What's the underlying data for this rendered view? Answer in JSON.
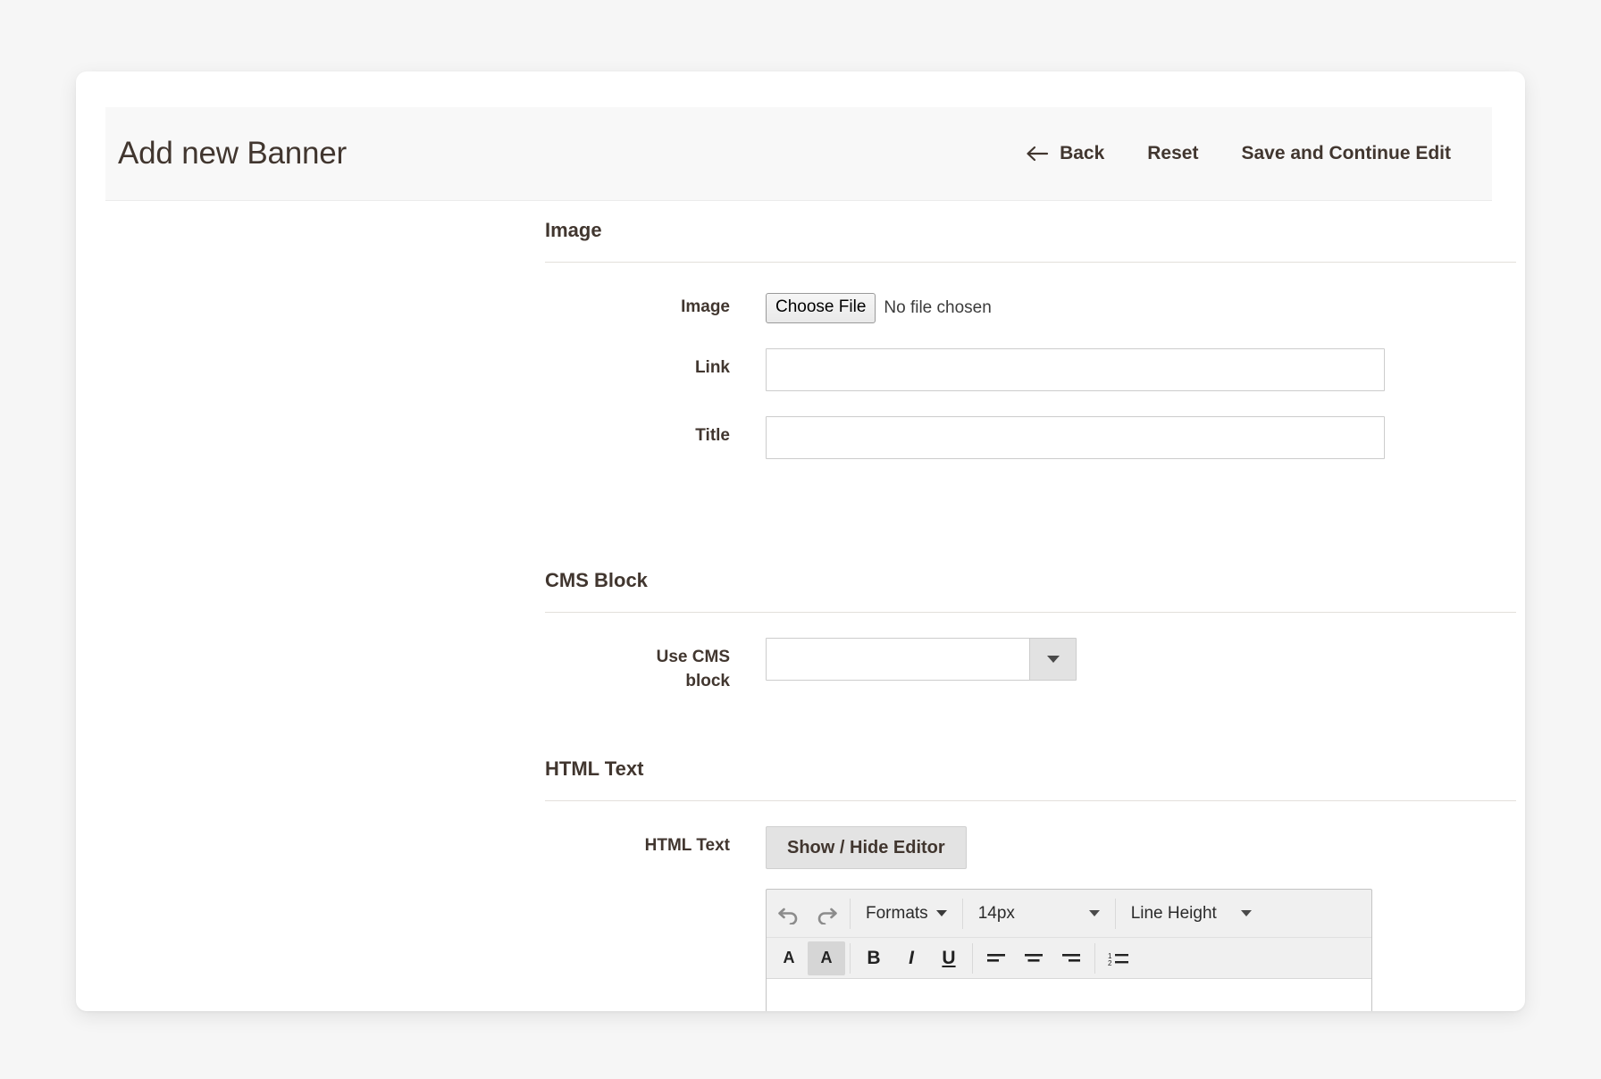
{
  "header": {
    "title": "Add new Banner",
    "actions": [
      {
        "id": "back",
        "label": "Back",
        "icon": "arrow-left-icon"
      },
      {
        "id": "reset",
        "label": "Reset",
        "icon": ""
      },
      {
        "id": "save",
        "label": "Save and Continue Edit",
        "icon": ""
      }
    ]
  },
  "fieldsets": {
    "image": {
      "legend": "Image",
      "fields": {
        "image": {
          "label": "Image",
          "button_label": "Choose File",
          "status": "No file chosen"
        },
        "link": {
          "label": "Link",
          "value": "",
          "placeholder": ""
        },
        "title": {
          "label": "Title",
          "value": "",
          "placeholder": ""
        }
      }
    },
    "cms_block": {
      "legend": "CMS Block",
      "fields": {
        "use_cms_block": {
          "label_line1": "Use CMS",
          "label_line2": "block",
          "value": "",
          "options": [
            ""
          ]
        }
      }
    },
    "html_text": {
      "legend": "HTML Text",
      "fields": {
        "html_text": {
          "label": "HTML Text",
          "toggle_label": "Show / Hide Editor"
        }
      }
    }
  },
  "editor": {
    "toolbar_row1": [
      {
        "id": "undo",
        "type": "icon",
        "name": "undo-icon",
        "label": ""
      },
      {
        "id": "redo",
        "type": "icon",
        "name": "redo-icon",
        "label": ""
      },
      {
        "id": "formats",
        "type": "menu",
        "name": "formats-menu",
        "label": "Formats"
      },
      {
        "id": "fontsize",
        "type": "menu",
        "name": "font-size-menu",
        "label": "14px"
      },
      {
        "id": "lineheight",
        "type": "menu",
        "name": "line-height-menu",
        "label": "Line Height"
      }
    ],
    "toolbar_row2": [
      {
        "id": "forecolor",
        "type": "icon",
        "name": "text-color-icon",
        "label": "A"
      },
      {
        "id": "backcolor",
        "type": "icon",
        "name": "background-color-icon",
        "label": "A"
      },
      {
        "id": "bold",
        "type": "icon",
        "name": "bold-icon",
        "label": "B"
      },
      {
        "id": "italic",
        "type": "icon",
        "name": "italic-icon",
        "label": "I"
      },
      {
        "id": "underline",
        "type": "icon",
        "name": "underline-icon",
        "label": "U"
      },
      {
        "id": "alignleft",
        "type": "icon",
        "name": "align-left-icon",
        "label": ""
      },
      {
        "id": "aligncenter",
        "type": "icon",
        "name": "align-center-icon",
        "label": ""
      },
      {
        "id": "alignright",
        "type": "icon",
        "name": "align-right-icon",
        "label": ""
      },
      {
        "id": "numlist",
        "type": "icon",
        "name": "numbered-list-icon",
        "label": ""
      }
    ]
  },
  "colors": {
    "page_bg": "#f6f6f6",
    "card_bg": "#ffffff",
    "header_bg": "#f8f8f8",
    "text": "#41362f",
    "rule": "#e3e0db",
    "input_border": "#cccccc"
  }
}
